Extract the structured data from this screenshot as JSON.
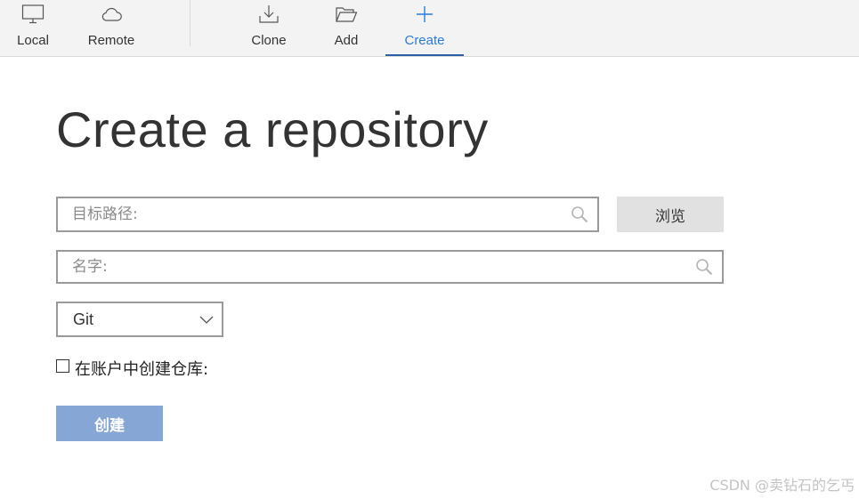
{
  "toolbar": {
    "items": [
      {
        "label": "Local",
        "icon": "monitor-icon"
      },
      {
        "label": "Remote",
        "icon": "cloud-icon"
      },
      {
        "label": "Clone",
        "icon": "download-icon"
      },
      {
        "label": "Add",
        "icon": "folder-open-icon"
      },
      {
        "label": "Create",
        "icon": "plus-icon",
        "active": true
      }
    ]
  },
  "main": {
    "title": "Create a repository",
    "path_field": {
      "placeholder": "目标路径:",
      "value": ""
    },
    "browse_label": "浏览",
    "name_field": {
      "placeholder": "名字:",
      "value": ""
    },
    "vcs_select": {
      "value": "Git"
    },
    "account_checkbox": {
      "label": "在账户中创建仓库:",
      "checked": false
    },
    "create_label": "创建"
  },
  "watermark": "CSDN @卖钻石的乞丐",
  "colors": {
    "accent": "#2b7bd6",
    "active_underline": "#2b5fa8",
    "create_button": "#86a6d6",
    "toolbar_bg": "#f3f3f3"
  }
}
